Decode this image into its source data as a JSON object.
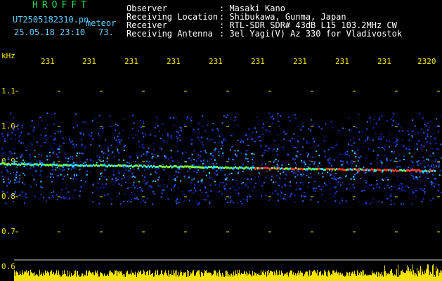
{
  "header": {
    "brand": "HROFFT",
    "filename": "UT2505182310.pn",
    "type": "meteor",
    "datetime": "25.05.18 23:10",
    "count": "73.",
    "info_labels": [
      "Observer",
      "Receiving Location",
      "Receiver",
      "Receiving Antenna"
    ],
    "info_values": [
      ": Masaki Kano",
      ": Shibukawa, Gunma, Japan",
      ": RTL-SDR SDR# 43dB L15 103.2MHz CW",
      ": 3el Yagi(V) Az 330 for Vladivostok"
    ]
  },
  "axis": {
    "unit": "kHz",
    "y_ticks": [
      "1.1",
      "1.0",
      "0.9",
      "0.8",
      "0.7",
      "0.6"
    ],
    "x_ticks": [
      "231",
      "231",
      "231",
      "231",
      "231",
      "231",
      "231",
      "231",
      "231",
      "2320"
    ]
  },
  "colors": {
    "background": "#000000",
    "label": "#f5e400",
    "signal": "#ff3b1f",
    "noise": "#1f4dff"
  }
}
